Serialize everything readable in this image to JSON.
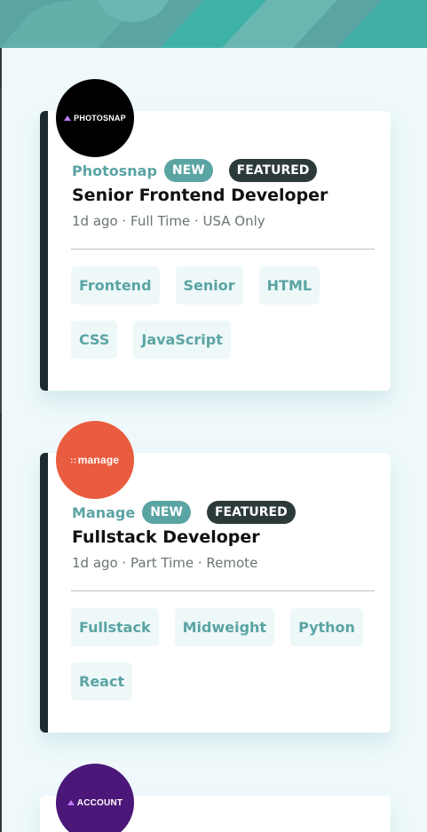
{
  "header": {
    "background_color": "#5ba4a4"
  },
  "colors": {
    "accent": "#5ba4a4",
    "dark": "#2c3a3a",
    "page_bg": "#eff9fb"
  },
  "jobs": [
    {
      "logo_text": "PHOTOSNAP",
      "logo_color": "#000000",
      "company": "Photosnap",
      "new_label": "NEW",
      "featured_label": "FEATURED",
      "position": "Senior Frontend Developer",
      "meta": "1d ago · Full Time · USA Only",
      "tags": [
        "Frontend",
        "Senior",
        "HTML",
        "CSS",
        "JavaScript"
      ]
    },
    {
      "logo_text": "manage",
      "logo_color": "#ea5c3f",
      "company": "Manage",
      "new_label": "NEW",
      "featured_label": "FEATURED",
      "position": "Fullstack Developer",
      "meta": "1d ago · Part Time · Remote",
      "tags": [
        "Fullstack",
        "Midweight",
        "Python",
        "React"
      ]
    },
    {
      "logo_text": "ACCOUNT",
      "logo_color": "#4b1778"
    }
  ]
}
